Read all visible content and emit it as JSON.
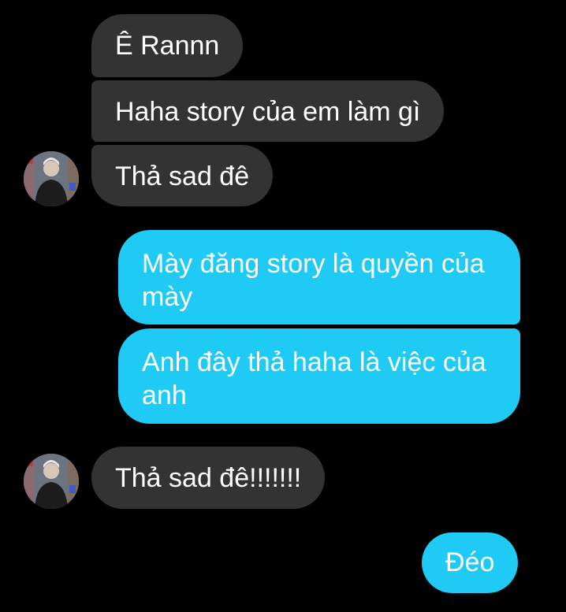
{
  "conversation": {
    "incoming_group_1": [
      "Ê Rannn",
      "Haha story của em làm gì",
      "Thả sad đê"
    ],
    "outgoing_group_1": [
      "Mày đăng story là quyền của mày",
      "Anh đây thả haha là việc của anh"
    ],
    "incoming_group_2": [
      "Thả sad đê!!!!!!!"
    ],
    "outgoing_group_2": [
      "Đéo"
    ]
  },
  "colors": {
    "background": "#000000",
    "incoming_bubble": "#333333",
    "outgoing_bubble": "#1fcbf5",
    "text": "#ffffff"
  },
  "icons": {
    "avatar": "user-avatar-photo"
  }
}
